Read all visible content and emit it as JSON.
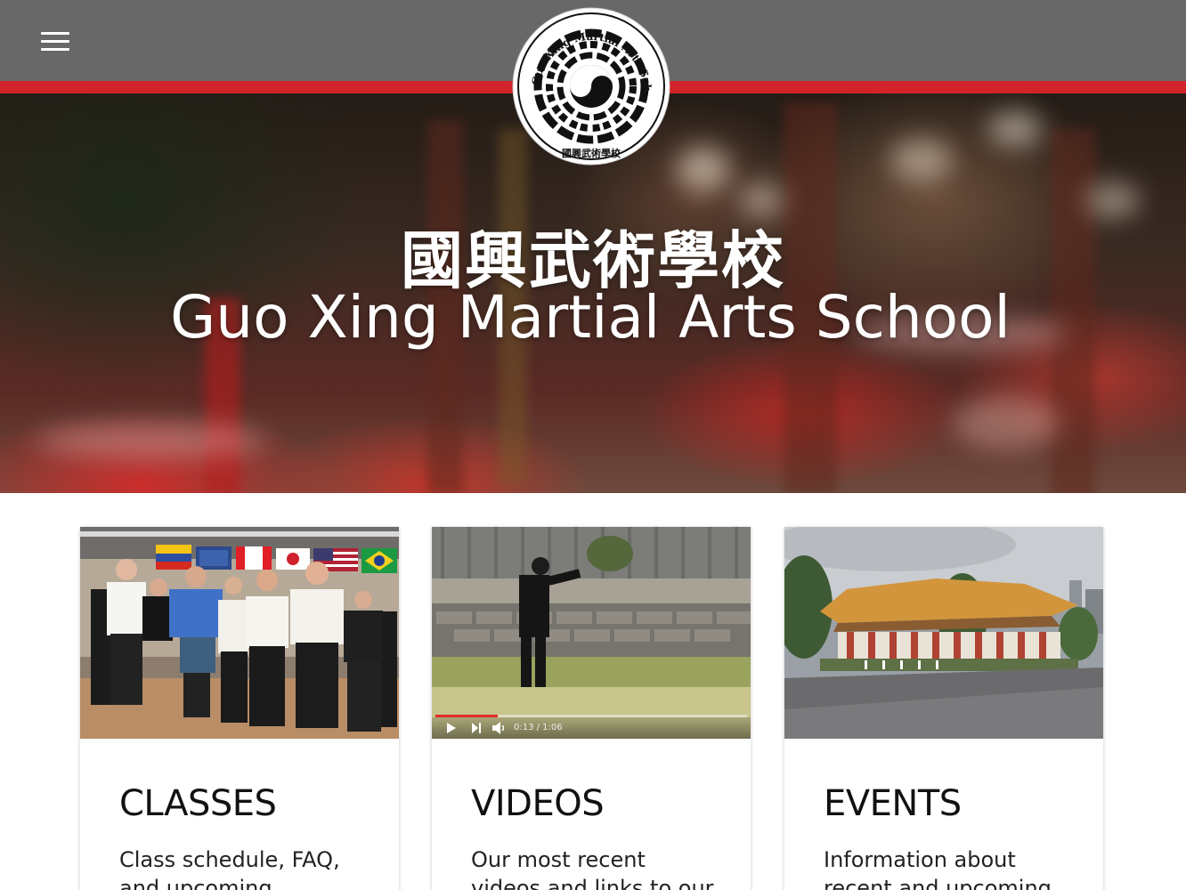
{
  "header": {
    "logo_ring_text": "Guo Xing Martial Arts School",
    "logo_cn_text": "國興武術學校"
  },
  "hero": {
    "title_cn": "國興武術學校",
    "title_en": "Guo Xing Martial Arts School"
  },
  "cards": [
    {
      "title": "CLASSES",
      "text": "Class schedule, FAQ, and upcoming"
    },
    {
      "title": "VIDEOS",
      "text": "Our most recent videos and links to our Youtube"
    },
    {
      "title": "EVENTS",
      "text": "Information about recent and upcoming"
    }
  ],
  "video_player": {
    "time": "0:13 / 1:06",
    "progress": 0.2
  },
  "colors": {
    "header_bg": "#686868",
    "accent_red": "#d2232a",
    "card_title": "#111111"
  },
  "icons": [
    "menu-icon",
    "play-icon",
    "next-icon",
    "volume-icon"
  ]
}
